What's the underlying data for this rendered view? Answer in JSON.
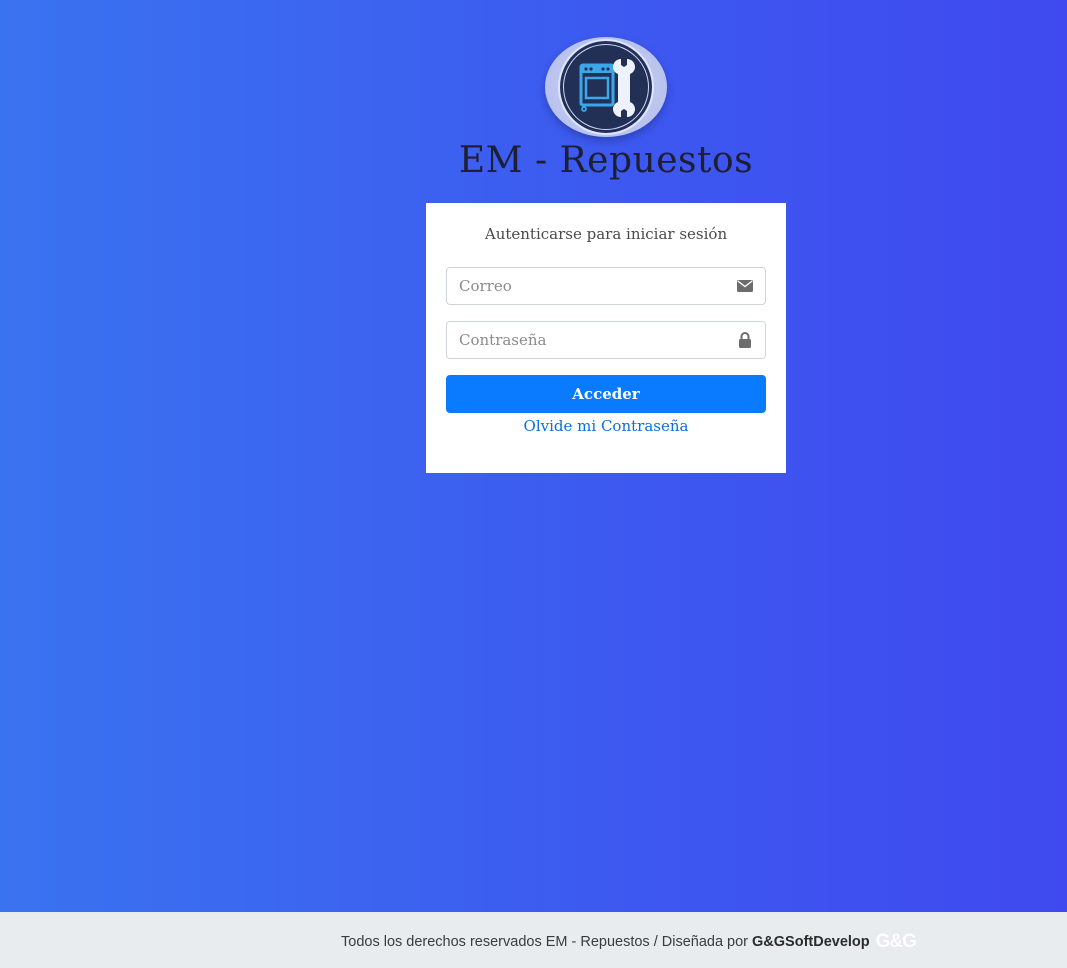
{
  "brand": {
    "title": "EM - Repuestos",
    "logo_icon": "stove-wrench-icon"
  },
  "login": {
    "message": "Autenticarse para iniciar sesión",
    "email": {
      "placeholder": "Correo",
      "value": "",
      "icon": "envelope-icon"
    },
    "password": {
      "placeholder": "Contraseña",
      "value": "",
      "icon": "lock-icon"
    },
    "submit_label": "Acceder",
    "forgot_label": "Olvide mi Contraseña"
  },
  "footer": {
    "text": "Todos los derechos reservados EM - Repuestos / Diseñada por",
    "company": "G&GSoftDevelop",
    "company_logo_text": "G&G"
  },
  "colors": {
    "background_start": "#3a73f0",
    "background_end": "#3f49ef",
    "primary_button": "#0a7bff",
    "link": "#0a6fe0",
    "footer_bg": "#e9ecef"
  }
}
